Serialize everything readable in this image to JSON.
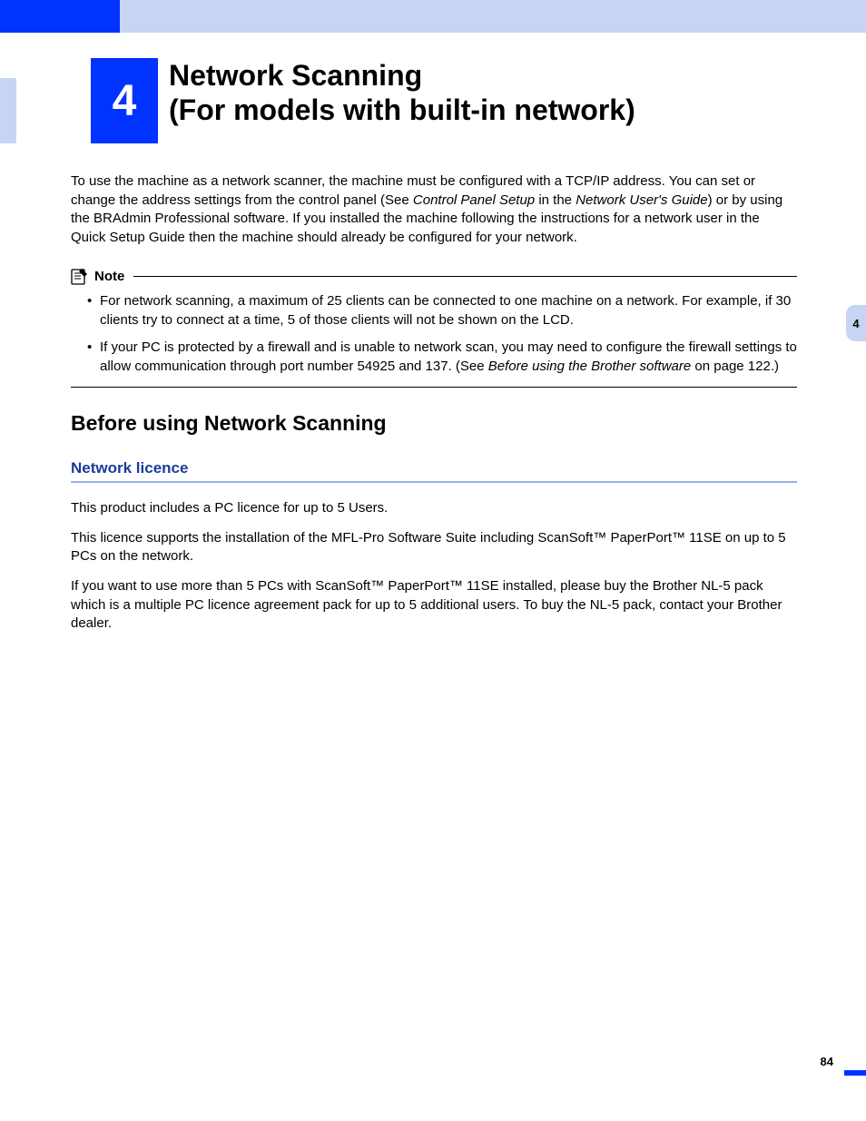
{
  "chapter": {
    "number": "4",
    "title_line1": "Network Scanning",
    "title_line2": "(For models with built-in network)"
  },
  "intro": {
    "text_before_italic1": "To use the machine as a network scanner, the machine must be configured with a TCP/IP address. You can set or change the address settings from the control panel (See ",
    "italic1": "Control Panel Setup",
    "text_mid1": " in the ",
    "italic2": "Network User's Guide",
    "text_after": ") or by using the BRAdmin Professional software. If you installed the machine following the instructions for a network user in the Quick Setup Guide then the machine should already be configured for your network."
  },
  "note": {
    "label": "Note",
    "items": [
      {
        "text": "For network scanning, a maximum of 25 clients can be connected to one machine on a network. For example, if 30 clients try to connect at a time, 5 of those clients will not be shown on the LCD.",
        "italic": "",
        "text_after": ""
      },
      {
        "text": "If your PC is protected by a firewall and is unable to network scan, you may need to configure the firewall settings to allow communication through port number 54925 and 137. (See ",
        "italic": "Before using the Brother software",
        "text_after": " on page 122.)"
      }
    ]
  },
  "section": {
    "h2": "Before using Network Scanning",
    "h3": "Network licence",
    "para1": "This product includes a PC licence for up to 5 Users.",
    "para2": "This licence supports the installation of the MFL-Pro Software Suite including ScanSoft™ PaperPort™ 11SE on up to 5 PCs on the network.",
    "para3": "If you want to use more than 5 PCs with ScanSoft™ PaperPort™ 11SE installed, please buy the Brother NL-5 pack which is a multiple PC licence agreement pack for up to 5 additional users. To buy the NL-5 pack, contact your Brother dealer."
  },
  "side_tab": "4",
  "page_number": "84"
}
